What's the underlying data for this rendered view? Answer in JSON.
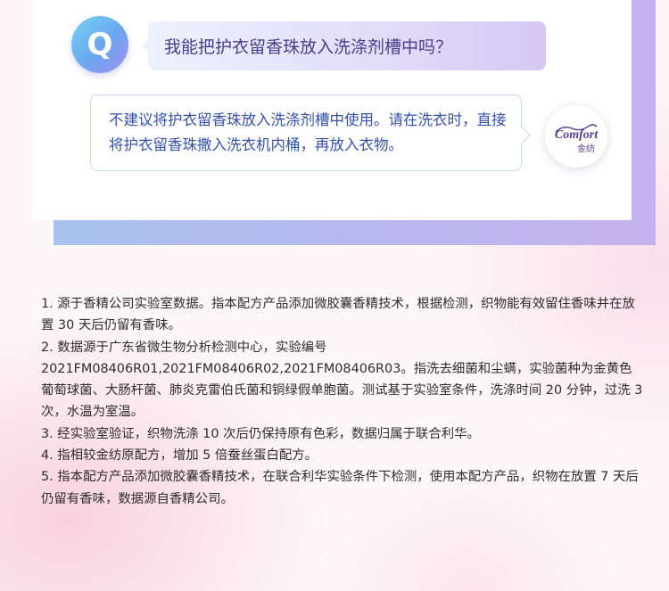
{
  "qa": {
    "q_badge": "Q",
    "question": "我能把护衣留香珠放入洗涤剂槽中吗？",
    "answer": "不建议将护衣留香珠放入洗涤剂槽中使用。请在洗衣时，直接将护衣留香珠撒入洗衣机内桶，再放入衣物。"
  },
  "logo": {
    "brand_text": "Comfort",
    "brand_text_cn": "金纺",
    "color": "#5b3b91"
  },
  "footnotes": [
    "1. 源于香精公司实验室数据。指本配方产品添加微胶囊香精技术，根据检测，织物能有效留住香味并在放置 30 天后仍留有香味。",
    "2. 数据源于广东省微生物分析检测中心，实验编号 2021FM08406R01,2021FM08406R02,2021FM08406R03。指洗去细菌和尘螨，实验菌种为金黄色葡萄球菌、大肠杆菌、肺炎克雷伯氏菌和铜绿假单胞菌。测试基于实验室条件，洗涤时间 20 分钟，过洗 3 次，水温为室温。",
    "3. 经实验室验证，织物洗涤 10 次后仍保持原有色彩，数据归属于联合利华。",
    "4. 指相较金纺原配方，增加 5 倍蚕丝蛋白配方。",
    "5. 指本配方产品添加微胶囊香精技术，在联合利华实验条件下检测，使用本配方产品，织物在放置 7 天后仍留有香味，数据源自香精公司。"
  ],
  "colors": {
    "question_text": "#4a3d8c",
    "answer_text": "#3552a8",
    "accent_blue": "#6aa6ee",
    "accent_purple": "#a58ff0"
  }
}
